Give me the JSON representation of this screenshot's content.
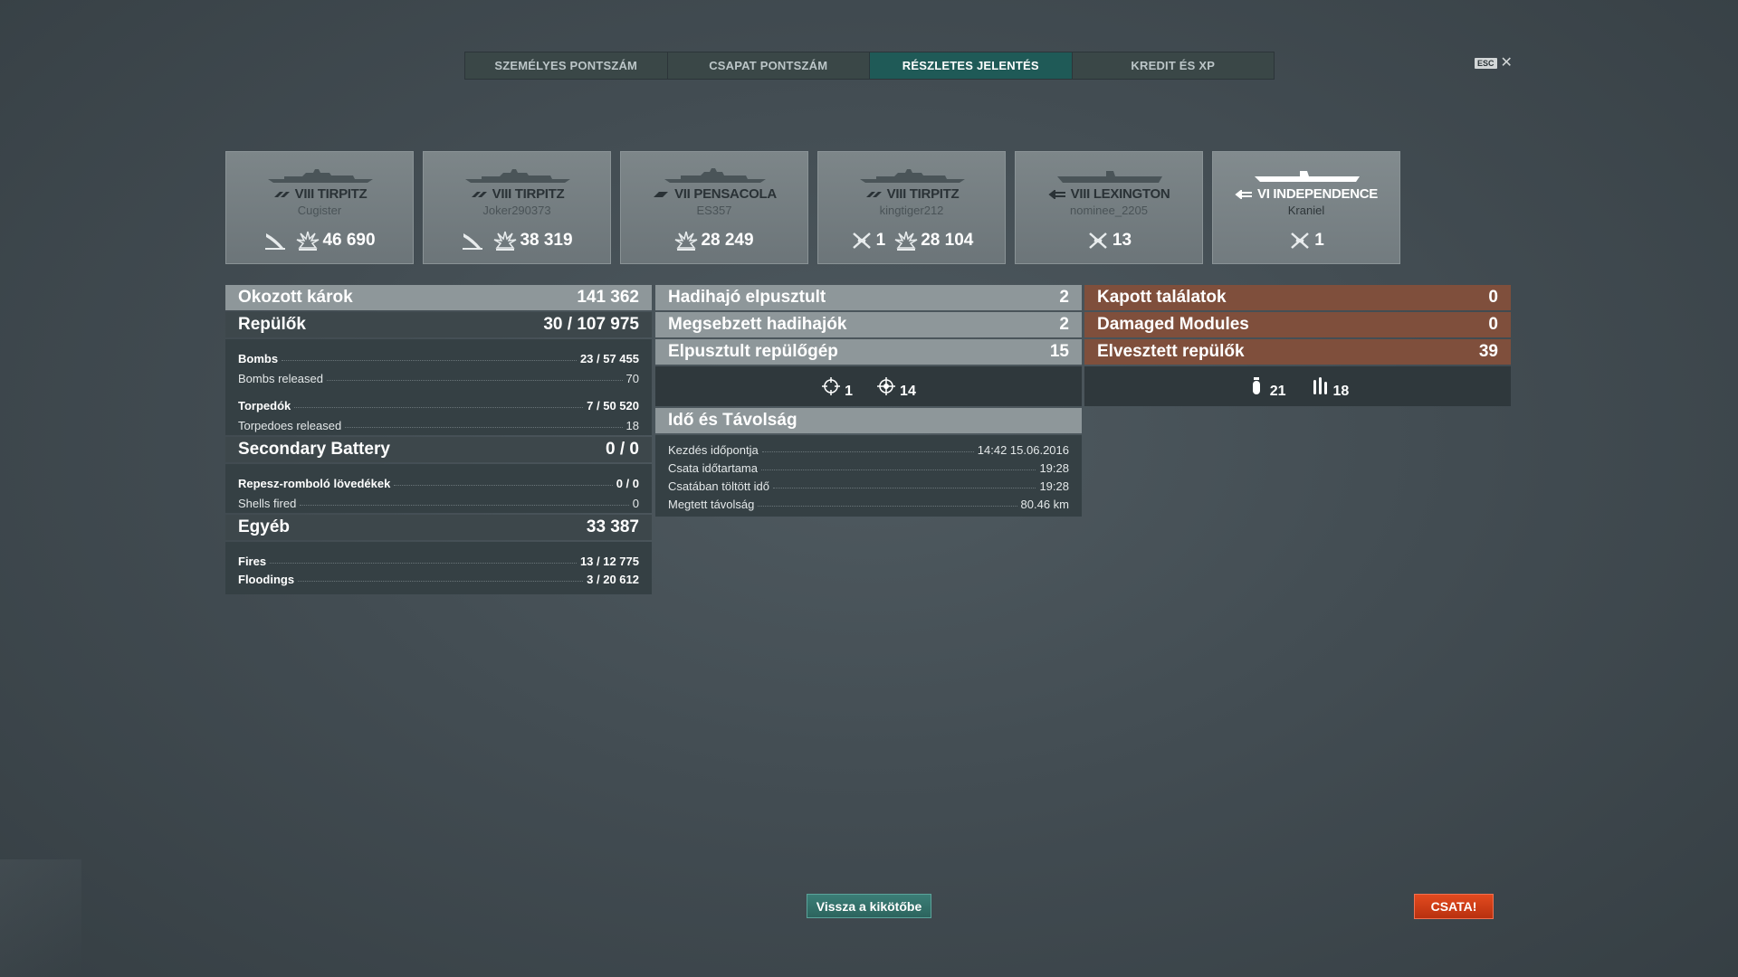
{
  "tabs": [
    {
      "label": "SZEMÉLYES PONTSZÁM",
      "active": false
    },
    {
      "label": "CSAPAT PONTSZÁM",
      "active": false
    },
    {
      "label": "RÉSZLETES JELENTÉS",
      "active": true
    },
    {
      "label": "KREDIT ÉS XP",
      "active": false
    }
  ],
  "esc": {
    "key": "ESC",
    "close": "✕"
  },
  "ships": [
    {
      "tier_name": "VIII TIRPITZ",
      "player": "Cugister",
      "medals": [
        {
          "icon": "flooding-medal-icon",
          "value": ""
        },
        {
          "icon": "damage-splash-icon",
          "value": "46 690"
        }
      ]
    },
    {
      "tier_name": "VIII TIRPITZ",
      "player": "Joker290373",
      "medals": [
        {
          "icon": "flooding-medal-icon",
          "value": ""
        },
        {
          "icon": "damage-splash-icon",
          "value": "38 319"
        }
      ]
    },
    {
      "tier_name": "VII PENSACOLA",
      "player": "ES357",
      "medals": [
        {
          "icon": "damage-splash-icon",
          "value": "28 249"
        }
      ]
    },
    {
      "tier_name": "VIII TIRPITZ",
      "player": "kingtiger212",
      "medals": [
        {
          "icon": "plane-destroyed-icon",
          "value": "1"
        },
        {
          "icon": "damage-splash-icon",
          "value": "28 104"
        }
      ]
    },
    {
      "tier_name": "VIII LEXINGTON",
      "player": "nominee_2205",
      "medals": [
        {
          "icon": "plane-destroyed-icon",
          "value": "13"
        }
      ]
    },
    {
      "tier_name": "VI INDEPENDENCE",
      "player": "Kraniel",
      "medals": [
        {
          "icon": "plane-destroyed-icon",
          "value": "1"
        }
      ]
    }
  ],
  "left": {
    "damage": {
      "label": "Okozott károk",
      "value": "141 362"
    },
    "planes": {
      "label": "Repülők",
      "value": "30 / 107 975"
    },
    "planes_rows": [
      {
        "label": "Bombs",
        "value": "23 / 57 455",
        "bold": true
      },
      {
        "label": "Bombs released",
        "value": "70",
        "bold": false
      },
      {
        "label": "Torpedók",
        "value": "7 / 50 520",
        "bold": true,
        "gap": true
      },
      {
        "label": "Torpedoes released",
        "value": "18",
        "bold": false
      }
    ],
    "secondary": {
      "label": "Secondary Battery",
      "value": "0 / 0"
    },
    "secondary_rows": [
      {
        "label": "Repesz-romboló lövedékek",
        "value": "0 / 0",
        "bold": true
      },
      {
        "label": "Shells fired",
        "value": "0",
        "bold": false
      }
    ],
    "other": {
      "label": "Egyéb",
      "value": "33 387"
    },
    "other_rows": [
      {
        "label": "Fires",
        "value": "13 / 12 775",
        "bold": true
      },
      {
        "label": "Floodings",
        "value": "3 / 20 612",
        "bold": true
      }
    ]
  },
  "middle": {
    "destroyed": {
      "label": "Hadihajó elpusztult",
      "value": "2"
    },
    "damaged": {
      "label": "Megsebzett hadihajók",
      "value": "2"
    },
    "planes_destroyed": {
      "label": "Elpusztult repülőgép",
      "value": "15"
    },
    "icons": [
      {
        "icon": "crosshair-icon",
        "value": "1"
      },
      {
        "icon": "aa-crosshair-icon",
        "value": "14"
      }
    ],
    "time_header": "Idő és Távolság",
    "time_rows": [
      {
        "label": "Kezdés időpontja",
        "value": "14:42  15.06.2016"
      },
      {
        "label": "Csata időtartama",
        "value": "19:28"
      },
      {
        "label": "Csatában töltött idő",
        "value": "19:28"
      },
      {
        "label": "Megtett távolság",
        "value": "80.46 km"
      }
    ]
  },
  "right": {
    "hits": {
      "label": "Kapott találatok",
      "value": "0"
    },
    "modules": {
      "label": "Damaged Modules",
      "value": "0"
    },
    "lost_planes": {
      "label": "Elvesztett repülők",
      "value": "39"
    },
    "icons": [
      {
        "icon": "bomb-icon",
        "value": "21"
      },
      {
        "icon": "torpedo-icon",
        "value": "18"
      }
    ]
  },
  "buttons": {
    "back": "Vissza a kikötőbe",
    "battle": "CSATA!"
  },
  "colors": {
    "accent_tab": "#1f5a57",
    "brown_panel": "#7f4f3c",
    "battle_button": "#d63c17",
    "back_button": "#2f6b65"
  }
}
